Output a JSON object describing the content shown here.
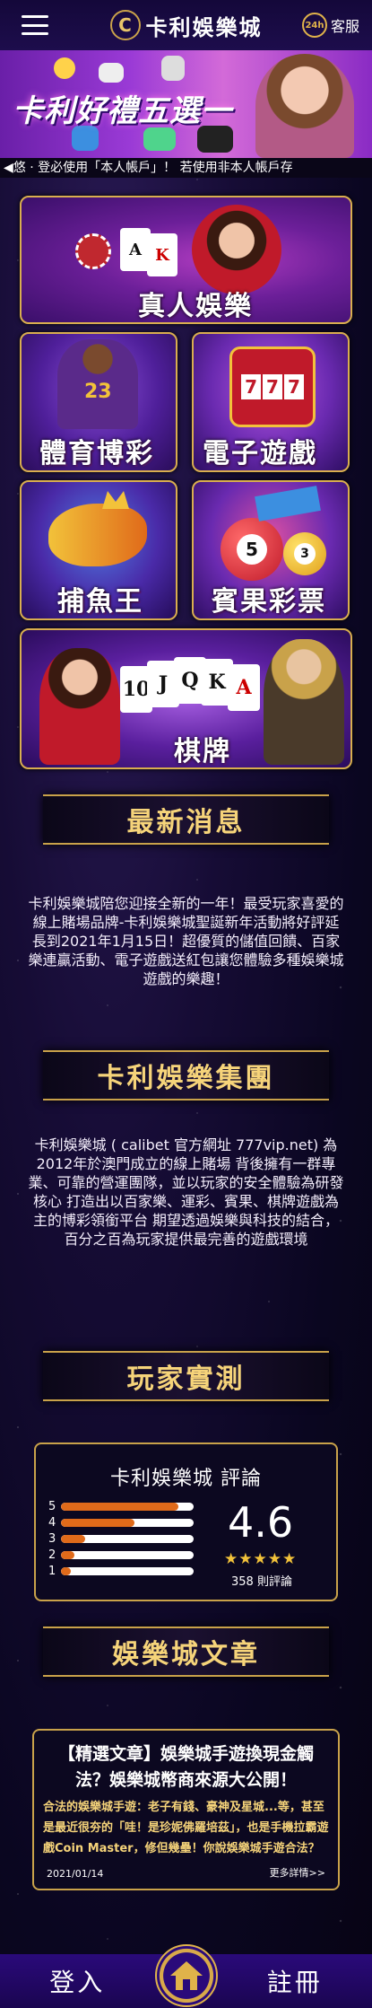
{
  "header": {
    "logo_mark": "C",
    "logo_text": "卡利娛樂城",
    "service_badge": "24h",
    "service_label": "客服"
  },
  "banner": {
    "title": "卡利好禮五選一"
  },
  "marquee": {
    "text": "◀悠 · 登必使用「本人帳戶」！ 若使用非本人帳戶存"
  },
  "games": {
    "live": "真人娛樂",
    "sport": "體育博彩",
    "slot": "電子遊戲",
    "fish": "捕魚王",
    "lottery": "賓果彩票",
    "chess": "棋牌"
  },
  "news": {
    "heading": "最新消息",
    "body": "卡利娛樂城陪您迎接全新的一年！最受玩家喜愛的線上賭場品牌-卡利娛樂城聖誕新年活動將好評延長到2021年1月15日！超優質的儲值回饋、百家樂連贏活動、電子遊戲送紅包讓您體驗多種娛樂城遊戲的樂趣！"
  },
  "group": {
    "heading": "卡利娛樂集團",
    "body": "卡利娛樂城 ( calibet 官方網址 777vip.net) 為2012年於澳門成立的線上賭場 背後擁有一群專業、可靠的營運團隊，並以玩家的安全體驗為研發核心 打造出以百家樂、運彩、賓果、棋牌遊戲為主的博彩領銜平台 期望透過娛樂與科技的結合，百分之百為玩家提供最完善的遊戲環境"
  },
  "reviews": {
    "heading": "玩家實測",
    "title": "卡利娛樂城  評論",
    "score": "4.6",
    "stars": "★★★★★",
    "count": "358 則評論",
    "bars": [
      {
        "label": "5",
        "fill": 0.88
      },
      {
        "label": "4",
        "fill": 0.55
      },
      {
        "label": "3",
        "fill": 0.18
      },
      {
        "label": "2",
        "fill": 0.1
      },
      {
        "label": "1",
        "fill": 0.07
      }
    ]
  },
  "articles": {
    "heading": "娛樂城文章",
    "title": "【精選文章】娛樂城手遊換現金觸法？娛樂城幣商來源大公開！",
    "body": "合法的娛樂城手遊：老子有錢、豪神及星城...等，甚至是最近很夯的「哇！是珍妮佛羅培茲」，也是手機拉霸遊戲Coin Master，修但幾壘！你說娛樂城手遊合法？",
    "date": "2021/01/14",
    "more": "更多詳情>>"
  },
  "bottom": {
    "login": "登入",
    "register": "註冊"
  },
  "colors": {
    "gold": "#c9a24a",
    "heading_gold": "#f6d47a",
    "bar_orange": "#e06a1a",
    "nav_purple": "#2a0a7a"
  }
}
